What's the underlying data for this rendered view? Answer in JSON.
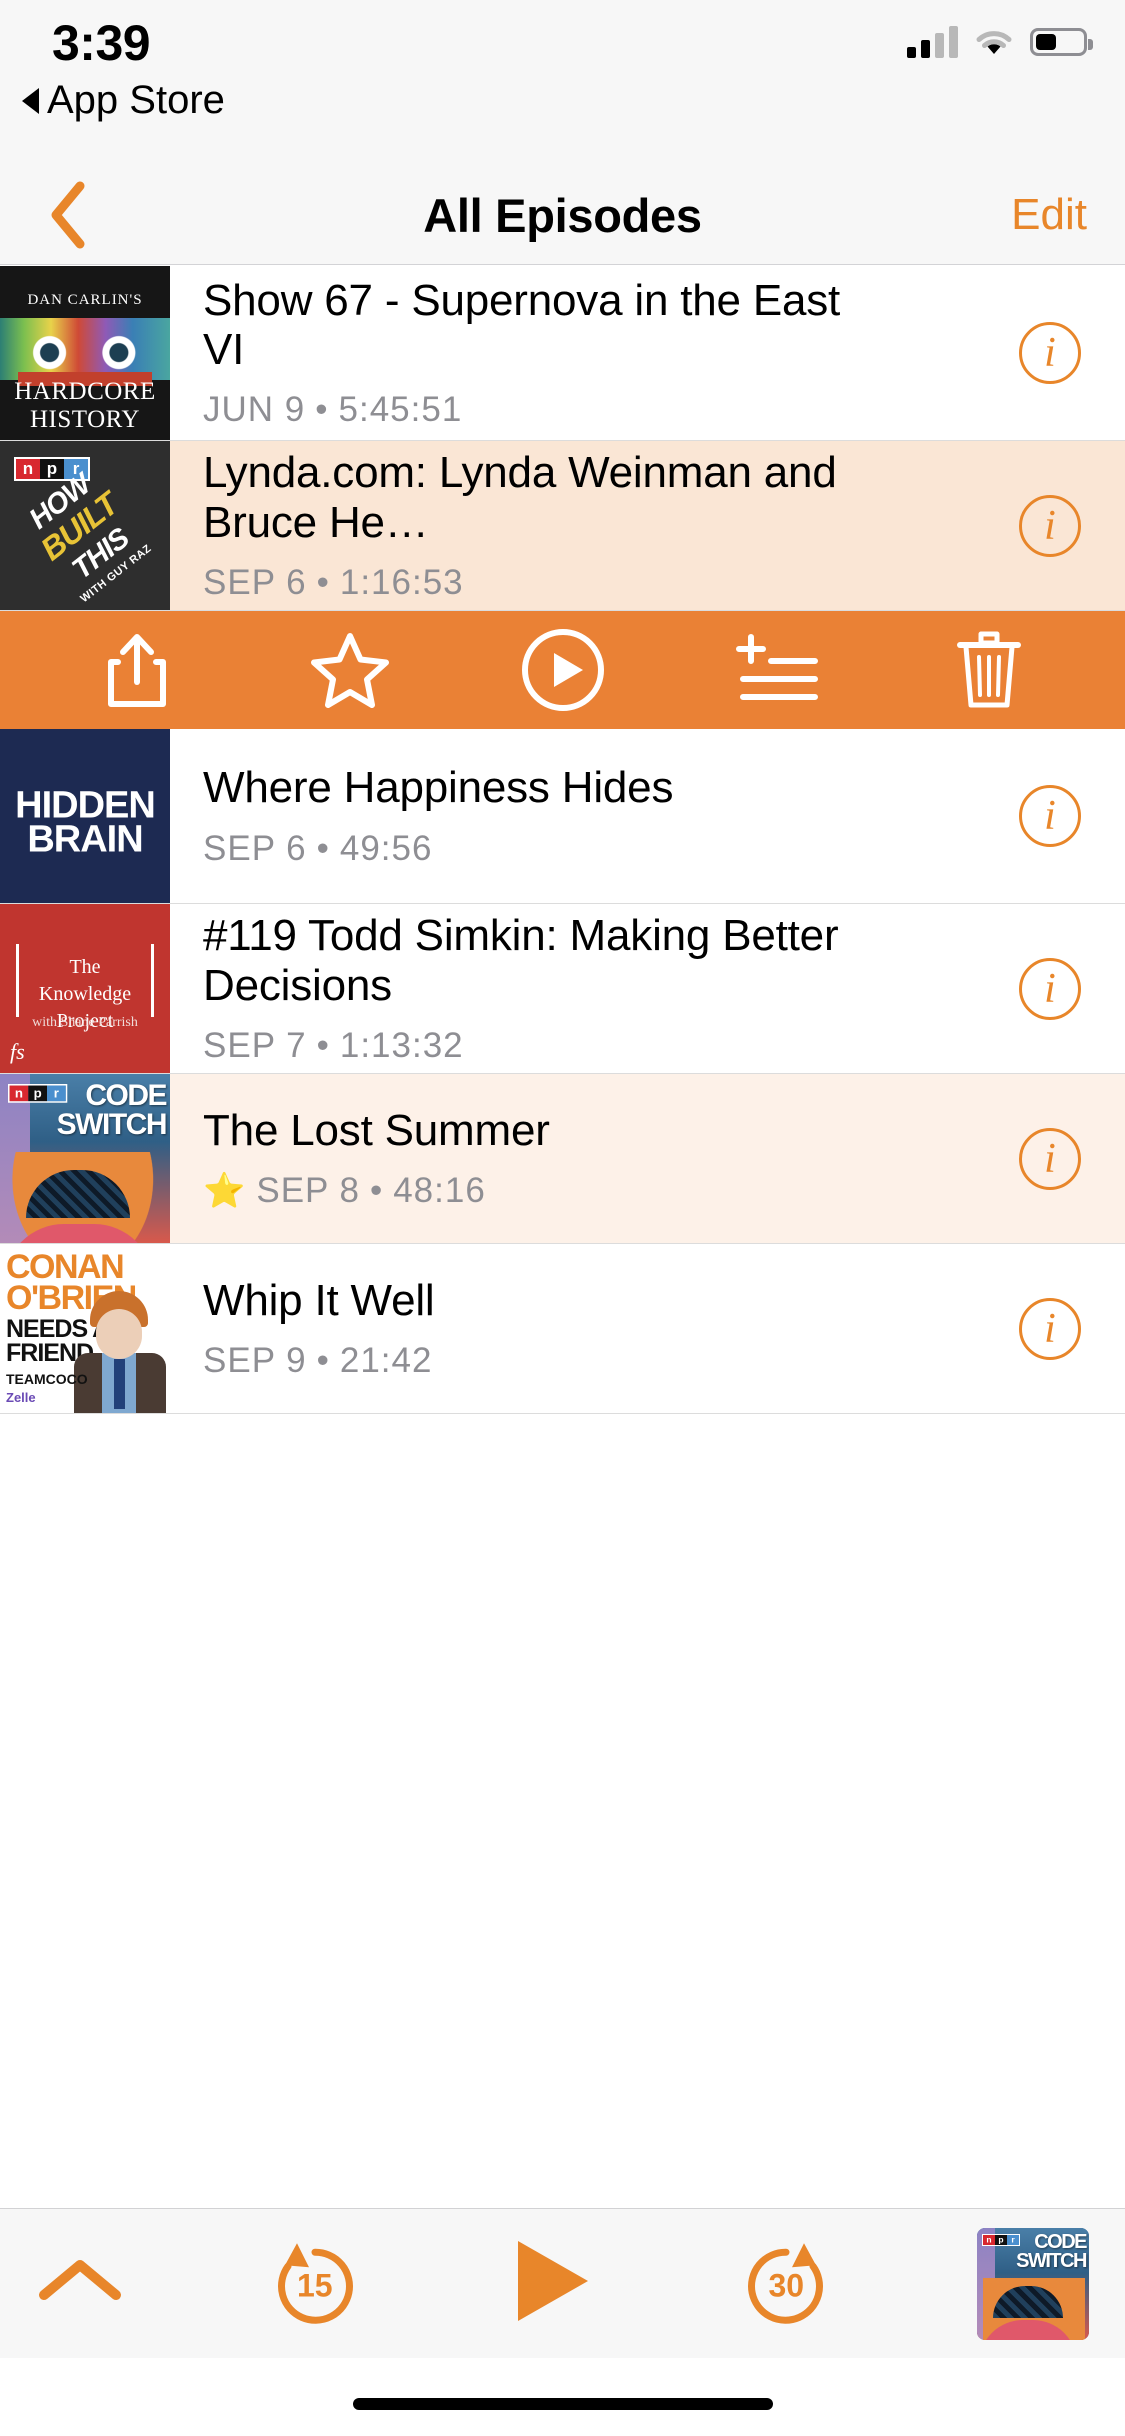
{
  "status_bar": {
    "time": "3:39",
    "back_app_label": "App Store",
    "back_triangle_icon": "left-triangle-icon",
    "signal_icon": "cellular-signal-icon",
    "wifi_icon": "wifi-icon",
    "battery_icon": "battery-icon"
  },
  "nav": {
    "back_icon": "chevron-left-icon",
    "title": "All Episodes",
    "edit_label": "Edit"
  },
  "colors": {
    "accent": "#e8862a",
    "action_bar": "#ea8135",
    "selected_row": "#fae6d5",
    "starred_row": "#fdf1e8",
    "bar_background": "#f7f7f7"
  },
  "episodes": [
    {
      "title": "Show 67 - Supernova in the East VI",
      "date": "JUN 9",
      "separator": "•",
      "duration": "5:45:51",
      "starred": false,
      "info_icon": "info-icon",
      "artwork_name": "hardcore-history-artwork",
      "artwork_text": {
        "line1": "DAN CARLIN'S",
        "line2": "HARDCORE",
        "line3": "HISTORY"
      }
    },
    {
      "title": "Lynda.com: Lynda Weinman and Bruce He…",
      "date": "SEP 6",
      "separator": "•",
      "duration": "1:16:53",
      "starred": false,
      "selected": true,
      "info_icon": "info-icon",
      "artwork_name": "how-i-built-this-artwork",
      "artwork_text": {
        "npr": [
          "n",
          "p",
          "r"
        ],
        "line1": "HOW",
        "line2": "BUILT",
        "line3": "THIS",
        "line4": "WITH GUY RAZ"
      }
    },
    {
      "title": "Where Happiness Hides",
      "date": "SEP 6",
      "separator": "•",
      "duration": "49:56",
      "starred": false,
      "info_icon": "info-icon",
      "artwork_name": "hidden-brain-artwork",
      "artwork_text": {
        "line1": "HIDDEN",
        "line2": "BRAIN"
      }
    },
    {
      "title": "#119 Todd Simkin: Making Better Decisions",
      "date": "SEP 7",
      "separator": "•",
      "duration": "1:13:32",
      "starred": false,
      "info_icon": "info-icon",
      "artwork_name": "knowledge-project-artwork",
      "artwork_text": {
        "line1": "The",
        "line2": "Knowledge",
        "line3": "Project",
        "line4": "with Shane Parrish",
        "line5": "fs"
      }
    },
    {
      "title": "The Lost Summer",
      "date": "SEP 8",
      "separator": "•",
      "duration": "48:16",
      "starred": true,
      "star_glyph": "⭐",
      "info_icon": "info-icon",
      "artwork_name": "code-switch-artwork",
      "artwork_text": {
        "npr": [
          "n",
          "p",
          "r"
        ],
        "line1": "CODE",
        "line2": "SWITCH"
      }
    },
    {
      "title": "Whip It Well",
      "date": "SEP 9",
      "separator": "•",
      "duration": "21:42",
      "starred": false,
      "info_icon": "info-icon",
      "artwork_name": "conan-obrien-artwork",
      "artwork_text": {
        "line1": "CONAN",
        "line2": "O'BRIEN",
        "line3": "NEEDS A",
        "line4": "FRIEND",
        "line5": "TEAMCOCO",
        "line6": "Zelle"
      }
    }
  ],
  "action_bar": {
    "share_icon": "share-icon",
    "star_icon": "star-icon",
    "play_icon": "play-circle-icon",
    "add_to_playlist_icon": "add-to-playlist-icon",
    "delete_icon": "trash-icon"
  },
  "player": {
    "expand_icon": "chevron-up-icon",
    "skip_back_icon": "skip-back-icon",
    "skip_back_label": "15",
    "play_icon": "play-triangle-icon",
    "skip_forward_icon": "skip-forward-icon",
    "skip_forward_label": "30",
    "now_playing_artwork": "code-switch-artwork",
    "now_playing_text": {
      "npr": [
        "n",
        "p",
        "r"
      ],
      "line1": "CODE",
      "line2": "SWITCH"
    }
  },
  "home_indicator": "home-indicator"
}
